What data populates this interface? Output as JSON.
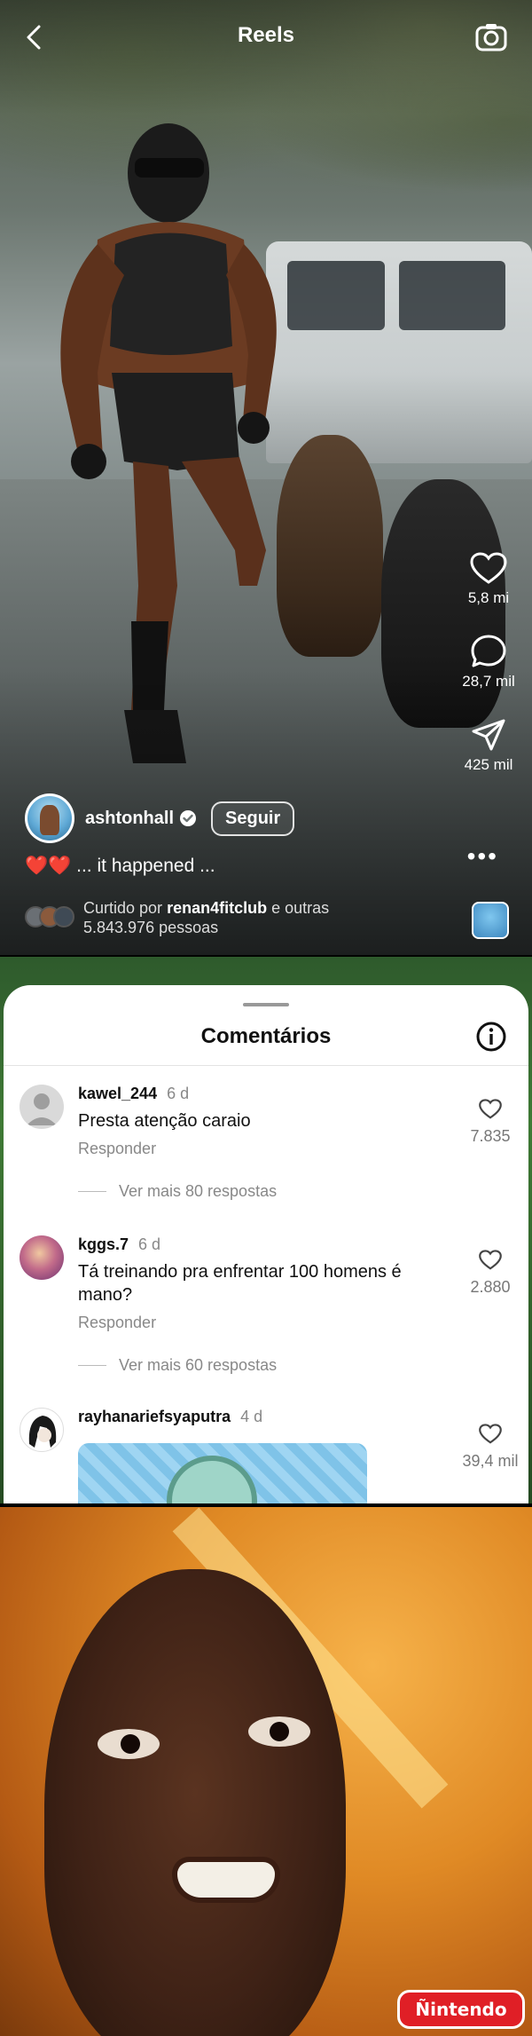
{
  "reel": {
    "title": "Reels",
    "author": "ashtonhall",
    "follow_label": "Seguir",
    "caption_hearts": "❤️❤️",
    "caption_text": "... it happened ...",
    "liked_prefix": "Curtido por",
    "liked_user": "renan4fitclub",
    "liked_suffix": "e outras",
    "liked_count": "5.843.976 pessoas",
    "likes": "5,8 mi",
    "comments": "28,7 mil",
    "shares": "425 mil",
    "more": "•••"
  },
  "comments_sheet": {
    "title": "Comentários",
    "items": [
      {
        "username": "kawel_244",
        "time": "6 d",
        "text": "Presta atenção caraio",
        "reply": "Responder",
        "more_replies": "Ver mais 80 respostas",
        "likes": "7.835"
      },
      {
        "username": "kggs.7",
        "time": "6 d",
        "text": "Tá treinando pra enfrentar 100 homens é mano?",
        "reply": "Responder",
        "more_replies": "Ver mais 60 respostas",
        "likes": "2.880"
      },
      {
        "username": "rayhanariefsyaputra",
        "time": "4 d",
        "likes": "39,4 mil"
      }
    ]
  },
  "meme": {
    "watermark": "Ñintendo"
  },
  "colors": {
    "accent_red": "#e01f26",
    "heart_red": "#e0261e",
    "muted_text": "#888888"
  },
  "icons": [
    "back-arrow-icon",
    "camera-icon",
    "heart-icon",
    "comment-icon",
    "share-icon",
    "more-icon",
    "verified-icon",
    "info-icon"
  ]
}
